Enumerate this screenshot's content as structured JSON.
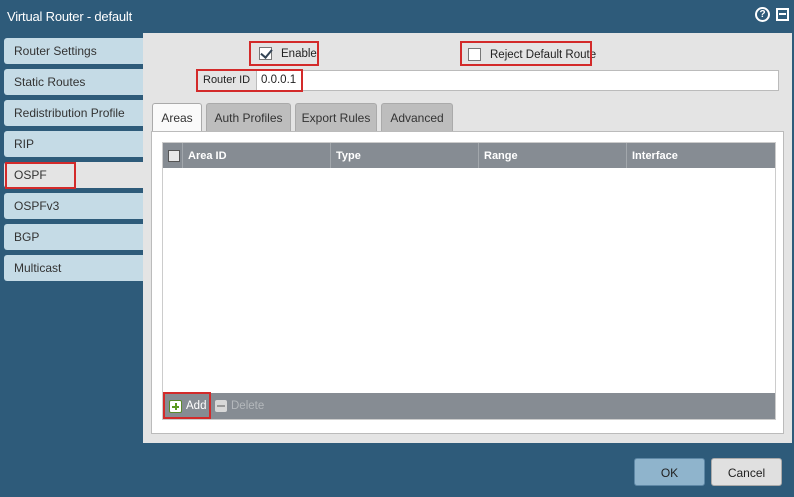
{
  "window": {
    "title": "Virtual Router - default",
    "help_glyph": "?"
  },
  "sidebar": {
    "items": [
      {
        "label": "Router Settings"
      },
      {
        "label": "Static Routes"
      },
      {
        "label": "Redistribution Profile"
      },
      {
        "label": "RIP"
      },
      {
        "label": "OSPF",
        "active": true
      },
      {
        "label": "OSPFv3"
      },
      {
        "label": "BGP"
      },
      {
        "label": "Multicast"
      }
    ]
  },
  "options": {
    "enable": {
      "label": "Enable",
      "checked": true
    },
    "reject_default_route": {
      "label": "Reject Default Route",
      "checked": false
    }
  },
  "router_id": {
    "label": "Router ID",
    "value": "0.0.0.1"
  },
  "tabs": [
    {
      "label": "Areas",
      "active": true
    },
    {
      "label": "Auth Profiles"
    },
    {
      "label": "Export Rules"
    },
    {
      "label": "Advanced"
    }
  ],
  "table": {
    "columns": [
      "Area ID",
      "Type",
      "Range",
      "Interface"
    ],
    "rows": []
  },
  "table_actions": {
    "add_label": "Add",
    "delete_label": "Delete"
  },
  "dialog_buttons": {
    "ok_label": "OK",
    "cancel_label": "Cancel"
  },
  "colors": {
    "highlight": "#d32a2a",
    "header_bg": "#2e5b7a",
    "grid_header": "#868c93"
  }
}
